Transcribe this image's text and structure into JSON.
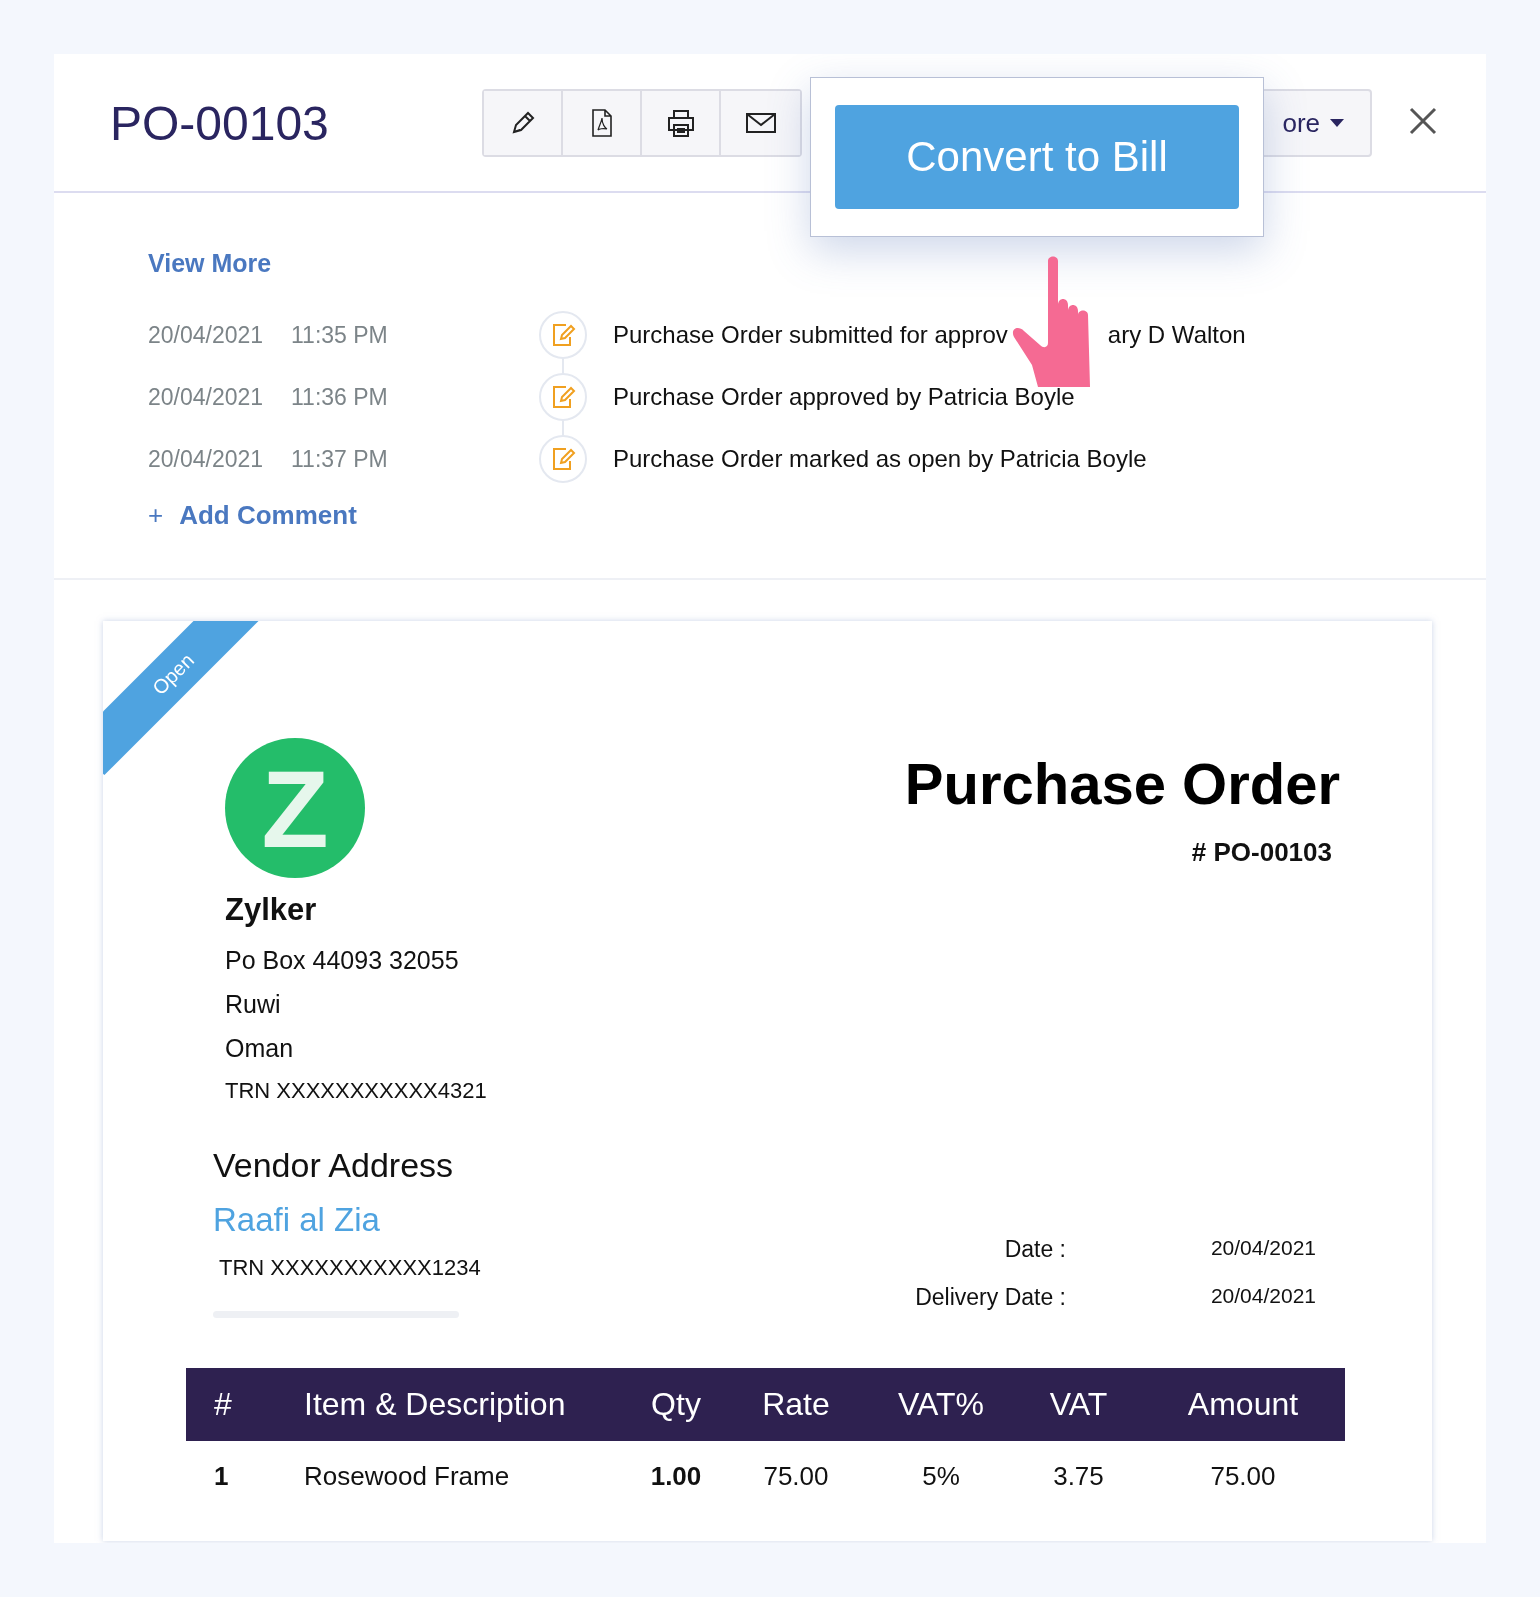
{
  "header": {
    "title": "PO-00103",
    "toolbar": [
      {
        "kind": "edit"
      },
      {
        "kind": "pdf"
      },
      {
        "kind": "print"
      },
      {
        "kind": "email"
      }
    ],
    "more": "ore"
  },
  "popup": {
    "button": "Convert to Bill"
  },
  "activity": {
    "view_more": "View More",
    "entries": [
      {
        "date": "20/04/2021",
        "time": "11:35 PM",
        "parts": [
          "Purchase Order submitted for approv",
          "ary D Walton"
        ]
      },
      {
        "date": "20/04/2021",
        "time": "11:36 PM",
        "parts": [
          "Purchase Order approved by Patricia Boyle"
        ]
      },
      {
        "date": "20/04/2021",
        "time": "11:37 PM",
        "parts": [
          "Purchase Order marked as open by Patricia Boyle"
        ]
      }
    ],
    "add_comment": {
      "icon": "+",
      "label": "Add Comment"
    }
  },
  "document": {
    "status": "Open",
    "logo_letter": "Z",
    "company": {
      "name": "Zylker",
      "address": [
        "Po Box 44093 32055",
        "Ruwi",
        "Oman"
      ],
      "trn": "TRN XXXXXXXXXXX4321"
    },
    "title": "Purchase Order",
    "number": "# PO-00103",
    "vendor": {
      "heading": "Vendor Address",
      "name": "Raafi al Zia",
      "trn": "TRN XXXXXXXXXXX1234"
    },
    "dates": [
      {
        "label": "Date :",
        "value": "20/04/2021"
      },
      {
        "label": "Delivery Date :",
        "value": "20/04/2021"
      }
    ],
    "table": {
      "columns": [
        "#",
        "Item & Description",
        "Qty",
        "Rate",
        "VAT%",
        "VAT",
        "Amount"
      ],
      "rows": [
        [
          "1",
          "Rosewood Frame",
          "1.00",
          "75.00",
          "5%",
          "3.75",
          "75.00"
        ]
      ]
    }
  }
}
